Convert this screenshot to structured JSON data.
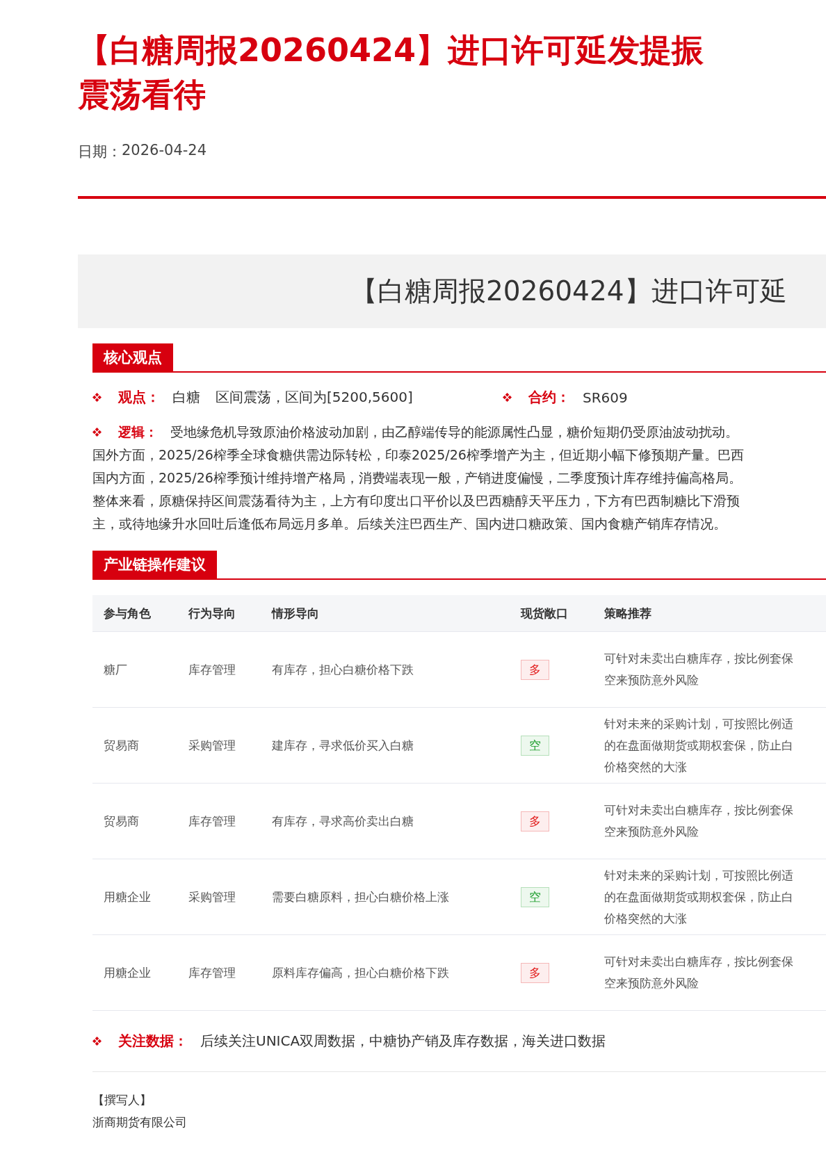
{
  "title_lines": [
    "【白糖周报20260424】进口许可延发提振",
    "震荡看待"
  ],
  "date": {
    "label": "日期：",
    "value": "2026-04-24"
  },
  "banner": "【白糖周报20260424】进口许可延",
  "sections": [
    {
      "heading": "核心观点"
    },
    {
      "heading": "产业链操作建议"
    }
  ],
  "view": {
    "label": "观点：",
    "items": [
      "白糖",
      "区间震荡，区间为[5200,5600]"
    ],
    "contract_label": "合约：",
    "contract": "SR609"
  },
  "logic": {
    "label": "逻辑：",
    "lines": [
      "受地缘危机导致原油价格波动加剧，由乙醇端传导的能源属性凸显，糖价短期仍受原油波动扰动。",
      "国外方面，2025/26榨季全球食糖供需边际转松，印泰2025/26榨季增产为主，但近期小幅下修预期产量。巴西",
      "国内方面，2025/26榨季预计维持增产格局，消费端表现一般，产销进度偏慢，二季度预计库存维持偏高格局。",
      "整体来看，原糖保持区间震荡看待为主，上方有印度出口平价以及巴西糖醇天平压力，下方有巴西制糖比下滑预",
      "主，或待地缘升水回吐后逢低布局远月多单。后续关注巴西生产、国内进口糖政策、国内食糖产销库存情况。"
    ]
  },
  "table": {
    "columns": [
      "参与角色",
      "行为导向",
      "情形导向",
      "现货敞口",
      "策略推荐"
    ],
    "rows": [
      {
        "role": "糖厂",
        "behavior": "库存管理",
        "situation": "有库存，担心白糖价格下跌",
        "exposure": {
          "kind": "long",
          "text": "多"
        },
        "strategy": [
          "可针对未卖出白糖库存，按比例套保",
          "空来预防意外风险"
        ]
      },
      {
        "role": "贸易商",
        "behavior": "采购管理",
        "situation": "建库存，寻求低价买入白糖",
        "exposure": {
          "kind": "short",
          "text": "空"
        },
        "strategy": [
          "针对未来的采购计划，可按照比例适",
          "的在盘面做期货或期权套保，防止白",
          "价格突然的大涨"
        ]
      },
      {
        "role": "贸易商",
        "behavior": "库存管理",
        "situation": "有库存，寻求高价卖出白糖",
        "exposure": {
          "kind": "long",
          "text": "多"
        },
        "strategy": [
          "可针对未卖出白糖库存，按比例套保",
          "空来预防意外风险"
        ]
      },
      {
        "role": "用糖企业",
        "behavior": "采购管理",
        "situation": "需要白糖原料，担心白糖价格上涨",
        "exposure": {
          "kind": "short",
          "text": "空"
        },
        "strategy": [
          "针对未来的采购计划，可按照比例适",
          "的在盘面做期货或期权套保，防止白",
          "价格突然的大涨"
        ]
      },
      {
        "role": "用糖企业",
        "behavior": "库存管理",
        "situation": "原料库存偏高，担心白糖价格下跌",
        "exposure": {
          "kind": "long",
          "text": "多"
        },
        "strategy": [
          "可针对未卖出白糖库存，按比例套保",
          "空来预防意外风险"
        ]
      }
    ]
  },
  "focus": {
    "label": "关注数据：",
    "text": "后续关注UNICA双周数据，中糖协产销及库存数据，海关进口数据"
  },
  "author": {
    "label": "【撰写人】",
    "company": "浙商期货有限公司"
  }
}
